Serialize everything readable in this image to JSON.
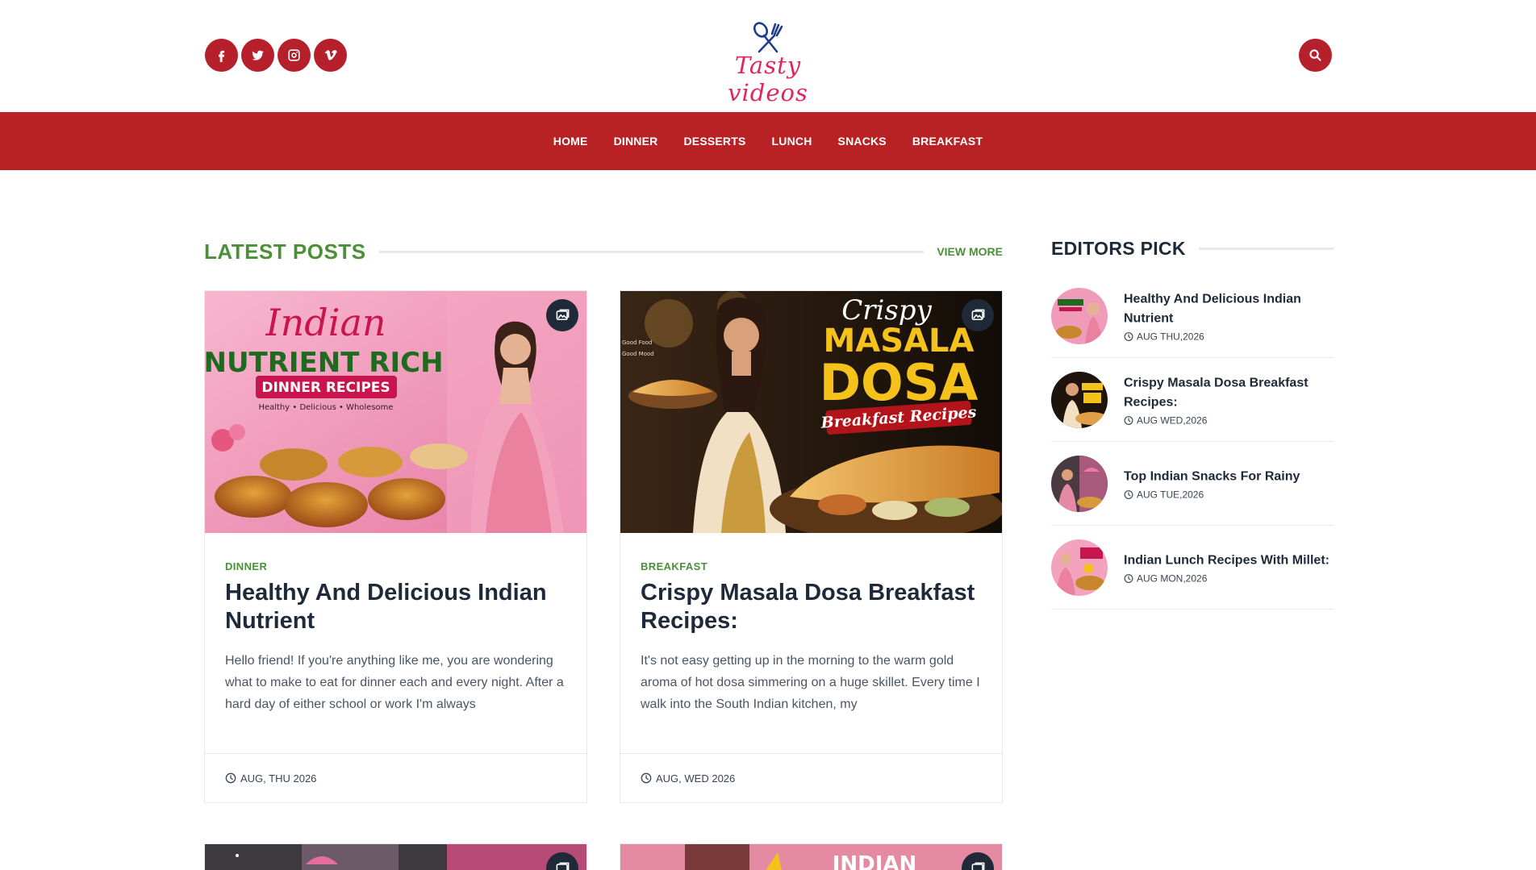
{
  "colors": {
    "accent": "#b92225",
    "green": "#4b8f37",
    "logo_pink": "#e2255f",
    "text_dark": "#1e2a3a"
  },
  "header": {
    "social_icons": [
      "facebook-icon",
      "twitter-icon",
      "instagram-icon",
      "vimeo-icon"
    ],
    "logo_text": "Tasty videos",
    "search_icon": "search-icon"
  },
  "nav": {
    "items": [
      "HOME",
      "DINNER",
      "DESSERTS",
      "LUNCH",
      "SNACKS",
      "BREAKFAST"
    ]
  },
  "latest": {
    "title": "LATEST POSTS",
    "view_more": "VIEW MORE",
    "posts": [
      {
        "category": "DINNER",
        "title": "Healthy And Delicious Indian Nutrient",
        "excerpt": "Hello friend! If you're anything like me, you are wondering what to make to eat for dinner each and every night. After a hard day of either school or work I'm always",
        "date": "AUG, THU 2026",
        "image_text": {
          "line1": "Indian",
          "line2": "NUTRIENT RICH",
          "line3": "DINNER RECIPES",
          "line4": "Healthy • Delicious • Wholesome"
        }
      },
      {
        "category": "BREAKFAST",
        "title": "Crispy Masala Dosa Breakfast Recipes:",
        "excerpt": "It's not easy getting up in the morning to the warm gold aroma of hot dosa simmering on a huge skillet. Every time I walk into the South Indian kitchen, my",
        "date": "AUG, WED 2026",
        "image_text": {
          "line1": "Crispy",
          "line2": "MASALA",
          "line3": "DOSA",
          "line4": "Breakfast Recipes",
          "line5": "Good Food",
          "line6": "Good Mood"
        }
      }
    ],
    "peek_text": "INDIAN"
  },
  "editors_pick": {
    "title": "EDITORS PICK",
    "items": [
      {
        "title": "Healthy And Delicious Indian Nutrient",
        "date": "AUG THU,2026"
      },
      {
        "title": "Crispy Masala Dosa Breakfast Recipes:",
        "date": "AUG WED,2026"
      },
      {
        "title": "Top Indian Snacks For Rainy",
        "date": "AUG TUE,2026"
      },
      {
        "title": "Indian Lunch Recipes With Millet:",
        "date": "AUG MON,2026"
      }
    ]
  }
}
